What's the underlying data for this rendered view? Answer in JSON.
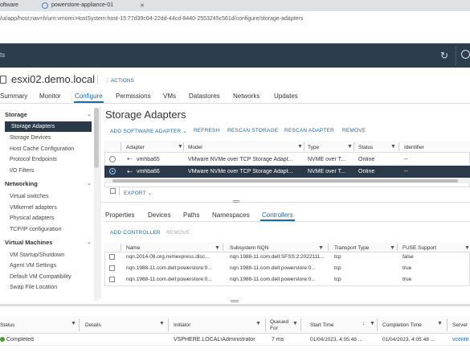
{
  "browser": {
    "tabs": [
      "oftware",
      "powerstore-appliance-01"
    ],
    "url": "/ui/app/host;nav=h/urn:vmomi:HostSystem:host-15:77d39c64-22dd-44cd-8440-2553245c561d/configure/storage-adapters"
  },
  "app": {
    "title_fragment": "ts"
  },
  "host": {
    "name": "esxi02.demo.local",
    "actions": "ACTIONS",
    "tabs": [
      "Summary",
      "Monitor",
      "Configure",
      "Permissions",
      "VMs",
      "Datastores",
      "Networks",
      "Updates"
    ],
    "active_tab": "Configure"
  },
  "sidebar": {
    "groups": [
      {
        "label": "Storage",
        "items": [
          "Storage Adapters",
          "Storage Devices",
          "Host Cache Configuration",
          "Protocol Endpoints",
          "I/O Filters"
        ]
      },
      {
        "label": "Networking",
        "items": [
          "Virtual switches",
          "VMkernel adapters",
          "Physical adapters",
          "TCP/IP configuration"
        ]
      },
      {
        "label": "Virtual Machines",
        "items": [
          "VM Startup/Shutdown",
          "Agent VM Settings",
          "Default VM Compatibility",
          "Swap File Location"
        ]
      }
    ],
    "selected": "Storage Adapters"
  },
  "main": {
    "title": "Storage Adapters",
    "toolbar": [
      "ADD SOFTWARE ADAPTER",
      "REFRESH",
      "RESCAN STORAGE",
      "RESCAN ADAPTER",
      "REMOVE"
    ],
    "columns": [
      "Adapter",
      "Model",
      "Type",
      "Status",
      "Identifier"
    ],
    "rows": [
      {
        "adapter": "vmhba65",
        "model": "VMware NVMe over TCP Storage Adapt...",
        "type": "NVME over T...",
        "status": "Online",
        "identifier": "--",
        "selected": false
      },
      {
        "adapter": "vmhba66",
        "model": "VMware NVMe over TCP Storage Adapt...",
        "type": "NVME over T...",
        "status": "Online",
        "identifier": "--",
        "selected": true
      }
    ],
    "export": "EXPORT",
    "detail_tabs": [
      "Properties",
      "Devices",
      "Paths",
      "Namespaces",
      "Controllers"
    ],
    "active_detail_tab": "Controllers",
    "detail_toolbar": [
      "ADD CONTROLLER",
      "REMOVE"
    ],
    "ctrl_columns": [
      "Name",
      "Subsystem NQN",
      "Transport Type",
      "FUSE Support"
    ],
    "ctrl_rows": [
      {
        "name": "nqn.2014-08.org.nvmexpress.disc...",
        "nqn": "nqn.1988-11.com.dell:SFSS:2:2022111...",
        "transport": "tcp",
        "fuse": "false"
      },
      {
        "name": "nqn.1988-11.com.dell:powerstore:0...",
        "nqn": "nqn.1988-11.com.dell:powerstore:0...",
        "transport": "tcp",
        "fuse": "true"
      },
      {
        "name": "nqn.1988-11.com.dell:powerstore:0...",
        "nqn": "nqn.1988-11.com.dell:powerstore:0...",
        "transport": "tcp",
        "fuse": "true"
      }
    ]
  },
  "tasks": {
    "columns": [
      "Status",
      "Details",
      "Initiator",
      "Queued For",
      "Start Time",
      "Completion Time",
      "Server"
    ],
    "rows": [
      {
        "status": "Completed",
        "details": "",
        "initiator": "VSPHERE.LOCAL\\Administrator",
        "queued": "7 ms",
        "start": "01/04/2023, 4:05:48 ...",
        "completion": "01/04/2023, 4:05:48 ...",
        "server": "vcente"
      }
    ]
  },
  "colors": {
    "header": "#2d3d4e",
    "accent": "#1a6aa8",
    "selected_row": "#2b3a4a",
    "active_item": "#2b3a4a"
  }
}
